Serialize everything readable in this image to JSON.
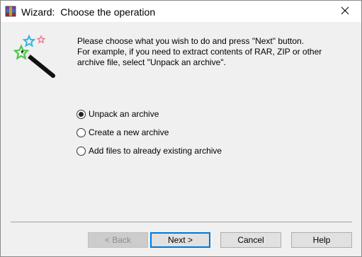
{
  "window": {
    "title": "Wizard:  Choose the operation"
  },
  "icons": {
    "app": "winrar-app-icon",
    "wizard": "magic-wand-icon",
    "close": "close-icon"
  },
  "instruction": {
    "text": "Please choose what you wish to do and press \"Next\" button.\nFor example, if you need to extract contents of RAR, ZIP or other\narchive file, select \"Unpack an archive\"."
  },
  "options": [
    {
      "label": "Unpack an archive",
      "selected": true
    },
    {
      "label": "Create a new archive",
      "selected": false
    },
    {
      "label": "Add files to already existing archive",
      "selected": false
    }
  ],
  "buttons": {
    "back": "< Back",
    "next": "Next >",
    "cancel": "Cancel",
    "help": "Help"
  },
  "colors": {
    "default_button_border": "#0078d7",
    "window_background": "#f0f0f0"
  }
}
